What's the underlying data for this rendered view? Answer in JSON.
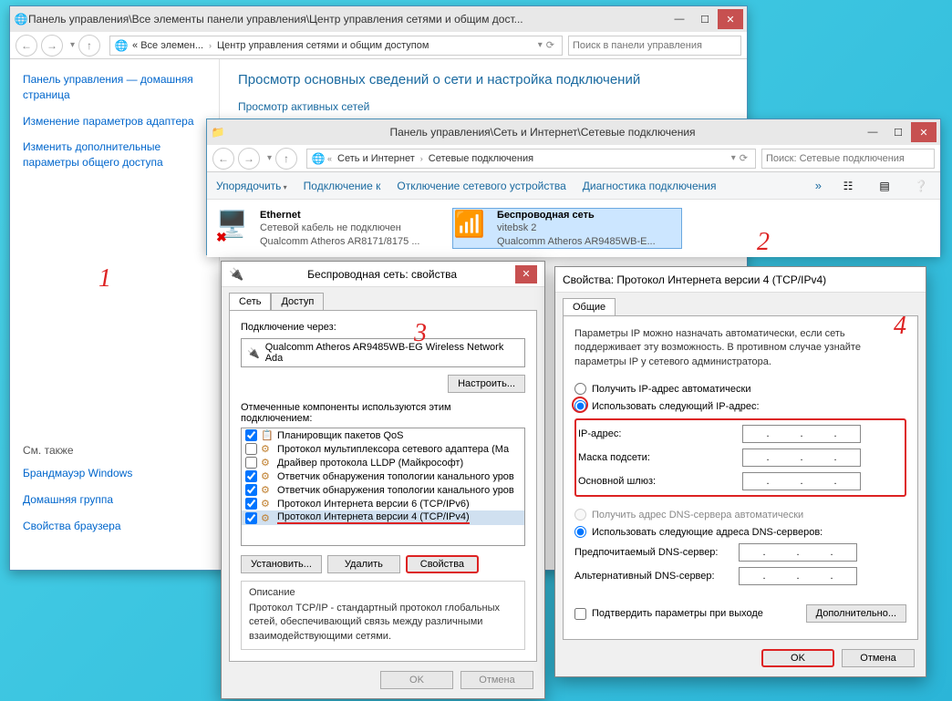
{
  "window1": {
    "title": "Панель управления\\Все элементы панели управления\\Центр управления сетями и общим дост...",
    "breadcrumb": [
      "« Все элемен...",
      "Центр управления сетями и общим доступом"
    ],
    "search_placeholder": "Поиск в панели управления",
    "sidebar": {
      "link1": "Панель управления — домашняя страница",
      "link2": "Изменение параметров адаптера",
      "link3": "Изменить дополнительные параметры общего доступа",
      "see_also": "См. также",
      "fw": "Брандмауэр Windows",
      "hg": "Домашняя группа",
      "bo": "Свойства браузера"
    },
    "main": {
      "heading": "Просмотр основных сведений о сети и настройка подключений",
      "subhead": "Просмотр активных сетей"
    }
  },
  "window2": {
    "title": "Панель управления\\Сеть и Интернет\\Сетевые подключения",
    "breadcrumb": [
      "Сеть и Интернет",
      "Сетевые подключения"
    ],
    "search_placeholder": "Поиск: Сетевые подключения",
    "cmdbar": {
      "organize": "Упорядочить",
      "connect": "Подключение к",
      "disable": "Отключение сетевого устройства",
      "diag": "Диагностика подключения"
    },
    "adapters": [
      {
        "name": "Ethernet",
        "status": "Сетевой кабель не подключен",
        "hw": "Qualcomm Atheros AR8171/8175 ..."
      },
      {
        "name": "Беспроводная сеть",
        "status": "vitebsk 2",
        "hw": "Qualcomm Atheros AR9485WB-E..."
      }
    ]
  },
  "dialog3": {
    "title": "Беспроводная сеть: свойства",
    "tabs": [
      "Сеть",
      "Доступ"
    ],
    "connect_via": "Подключение через:",
    "adapter": "Qualcomm Atheros AR9485WB-EG Wireless Network Ada",
    "configure": "Настроить...",
    "components_label": "Отмеченные компоненты используются этим подключением:",
    "components": [
      {
        "checked": true,
        "label": "Планировщик пакетов QoS"
      },
      {
        "checked": false,
        "label": "Протокол мультиплексора сетевого адаптера (Ма"
      },
      {
        "checked": false,
        "label": "Драйвер протокола LLDP (Майкрософт)"
      },
      {
        "checked": true,
        "label": "Ответчик обнаружения топологии канального уров"
      },
      {
        "checked": true,
        "label": "Ответчик обнаружения топологии канального уров"
      },
      {
        "checked": true,
        "label": "Протокол Интернета версии 6 (TCP/IPv6)"
      },
      {
        "checked": true,
        "label": "Протокол Интернета версии 4 (TCP/IPv4)"
      }
    ],
    "install": "Установить...",
    "remove": "Удалить",
    "properties": "Свойства",
    "desc_head": "Описание",
    "desc": "Протокол TCP/IP - стандартный протокол глобальных сетей, обеспечивающий связь между различными взаимодействующими сетями.",
    "ok": "OK",
    "cancel": "Отмена"
  },
  "dialog4": {
    "title": "Свойства: Протокол Интернета версии 4 (TCP/IPv4)",
    "tab": "Общие",
    "intro": "Параметры IP можно назначать автоматически, если сеть поддерживает эту возможность. В противном случае узнайте параметры IP у сетевого администратора.",
    "auto_ip": "Получить IP-адрес автоматически",
    "use_ip": "Использовать следующий IP-адрес:",
    "ip_addr": "IP-адрес:",
    "mask": "Маска подсети:",
    "gateway": "Основной шлюз:",
    "auto_dns": "Получить адрес DNS-сервера автоматически",
    "use_dns": "Использовать следующие адреса DNS-серверов:",
    "dns1": "Предпочитаемый DNS-сервер:",
    "dns2": "Альтернативный DNS-сервер:",
    "validate": "Подтвердить параметры при выходе",
    "advanced": "Дополнительно...",
    "ok": "OK",
    "cancel": "Отмена"
  },
  "annotations": {
    "n1": "1",
    "n2": "2",
    "n3": "3",
    "n4": "4"
  }
}
